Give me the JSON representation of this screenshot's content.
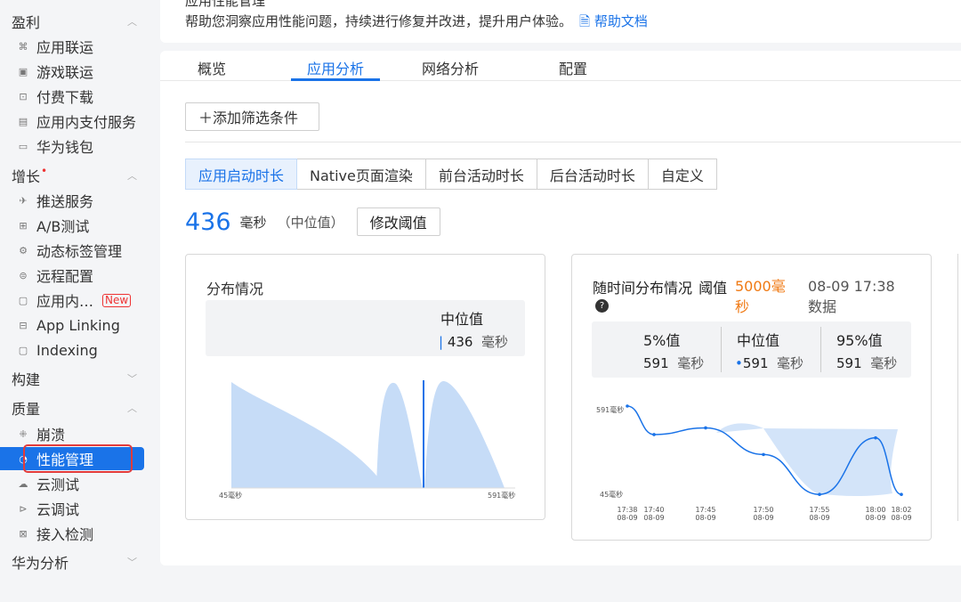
{
  "sidebar": {
    "sections": [
      {
        "label": "盈利"
      },
      {
        "label": "增长"
      },
      {
        "label": "构建"
      },
      {
        "label": "质量"
      },
      {
        "label": "华为分析"
      }
    ],
    "items": [
      {
        "label": "应用联运",
        "icon": "link-icon"
      },
      {
        "label": "游戏联运",
        "icon": "game-icon"
      },
      {
        "label": "付费下载",
        "icon": "download-icon"
      },
      {
        "label": "应用内支付服务",
        "icon": "payment-icon"
      },
      {
        "label": "华为钱包",
        "icon": "wallet-icon"
      },
      {
        "label": "推送服务",
        "icon": "push-icon"
      },
      {
        "label": "A/B测试",
        "icon": "ab-test-icon"
      },
      {
        "label": "动态标签管理",
        "icon": "tag-icon"
      },
      {
        "label": "远程配置",
        "icon": "config-icon"
      },
      {
        "label": "应用内…",
        "icon": "message-icon",
        "badge": "New"
      },
      {
        "label": "App Linking",
        "icon": "applink-icon"
      },
      {
        "label": "Indexing",
        "icon": "index-icon"
      },
      {
        "label": "崩溃",
        "icon": "crash-icon"
      },
      {
        "label": "性能管理",
        "icon": "performance-icon"
      },
      {
        "label": "云测试",
        "icon": "cloud-test-icon"
      },
      {
        "label": "云调试",
        "icon": "cloud-debug-icon"
      },
      {
        "label": "接入检测",
        "icon": "check-icon"
      }
    ]
  },
  "header": {
    "title": "应用性能管理",
    "description": "帮助您洞察应用性能问题，持续进行修复并改进，提升用户体验。",
    "help_link": "帮助文档"
  },
  "tabs": [
    "概览",
    "应用分析",
    "网络分析",
    "配置"
  ],
  "filter_button": "＋添加筛选条件",
  "subtabs": [
    "应用启动时长",
    "Native页面渲染",
    "前台活动时长",
    "后台活动时长",
    "自定义"
  ],
  "metric": {
    "value": "436",
    "unit": "毫秒",
    "note": "（中位值）",
    "edit_button": "修改阈值"
  },
  "distribution": {
    "title": "分布情况",
    "median_label": "中位值",
    "median_value": "436",
    "median_unit": "毫秒",
    "x_min": "45毫秒",
    "x_max": "591毫秒"
  },
  "time_distribution": {
    "title": "随时间分布情况",
    "threshold_label": "阈值",
    "threshold_value": "5000毫秒",
    "timestamp": "08-09 17:38",
    "data_label": "数据",
    "p5_label": "5%值",
    "p5_value": "591",
    "median_label": "中位值",
    "median_value": "591",
    "p95_label": "95%值",
    "p95_value": "591",
    "unit": "毫秒",
    "y_max": "591毫秒",
    "y_min": "45毫秒"
  },
  "chart_data": {
    "type": "line",
    "x": [
      "17:38 08-09",
      "17:40 08-09",
      "17:45 08-09",
      "17:50 08-09",
      "17:55 08-09",
      "18:00 08-09",
      "18:02 08-09"
    ],
    "ylim": [
      45,
      591
    ],
    "series": [
      {
        "values": [
          591,
          420,
          460,
          300,
          60,
          400,
          60
        ]
      }
    ]
  }
}
